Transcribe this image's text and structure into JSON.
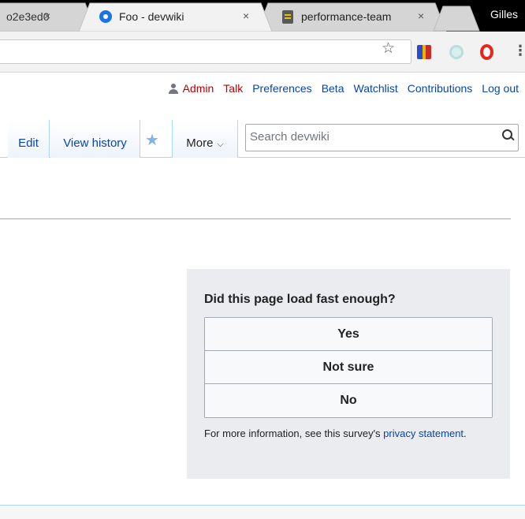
{
  "browser": {
    "tabs": [
      {
        "title": "o2e3ed0",
        "close": "×"
      },
      {
        "title": "Foo - devwiki",
        "close": "×"
      },
      {
        "title": "performance-team",
        "close": "×"
      }
    ],
    "profile_name": "Gilles",
    "bookmark_glyph": "☆",
    "menu_glyph": "⋮"
  },
  "personal_tools": {
    "user": "Admin",
    "links": [
      "Talk",
      "Preferences",
      "Beta",
      "Watchlist",
      "Contributions",
      "Log out"
    ]
  },
  "page_tabs": {
    "edit": "Edit",
    "view_history": "View history",
    "watch_glyph": "★",
    "more": "More",
    "more_chevron": "⌵"
  },
  "search": {
    "placeholder": "Search devwiki"
  },
  "survey": {
    "question": "Did this page load fast enough?",
    "options": [
      "Yes",
      "Not sure",
      "No"
    ],
    "footer_text": "For more information, see this survey's ",
    "footer_link": "privacy statement",
    "footer_end": "."
  },
  "colors": {
    "link": "#0645ad",
    "red_link": "#ba0000",
    "survey_bg": "#eaecf0",
    "tab_border": "#a7d7f9"
  }
}
